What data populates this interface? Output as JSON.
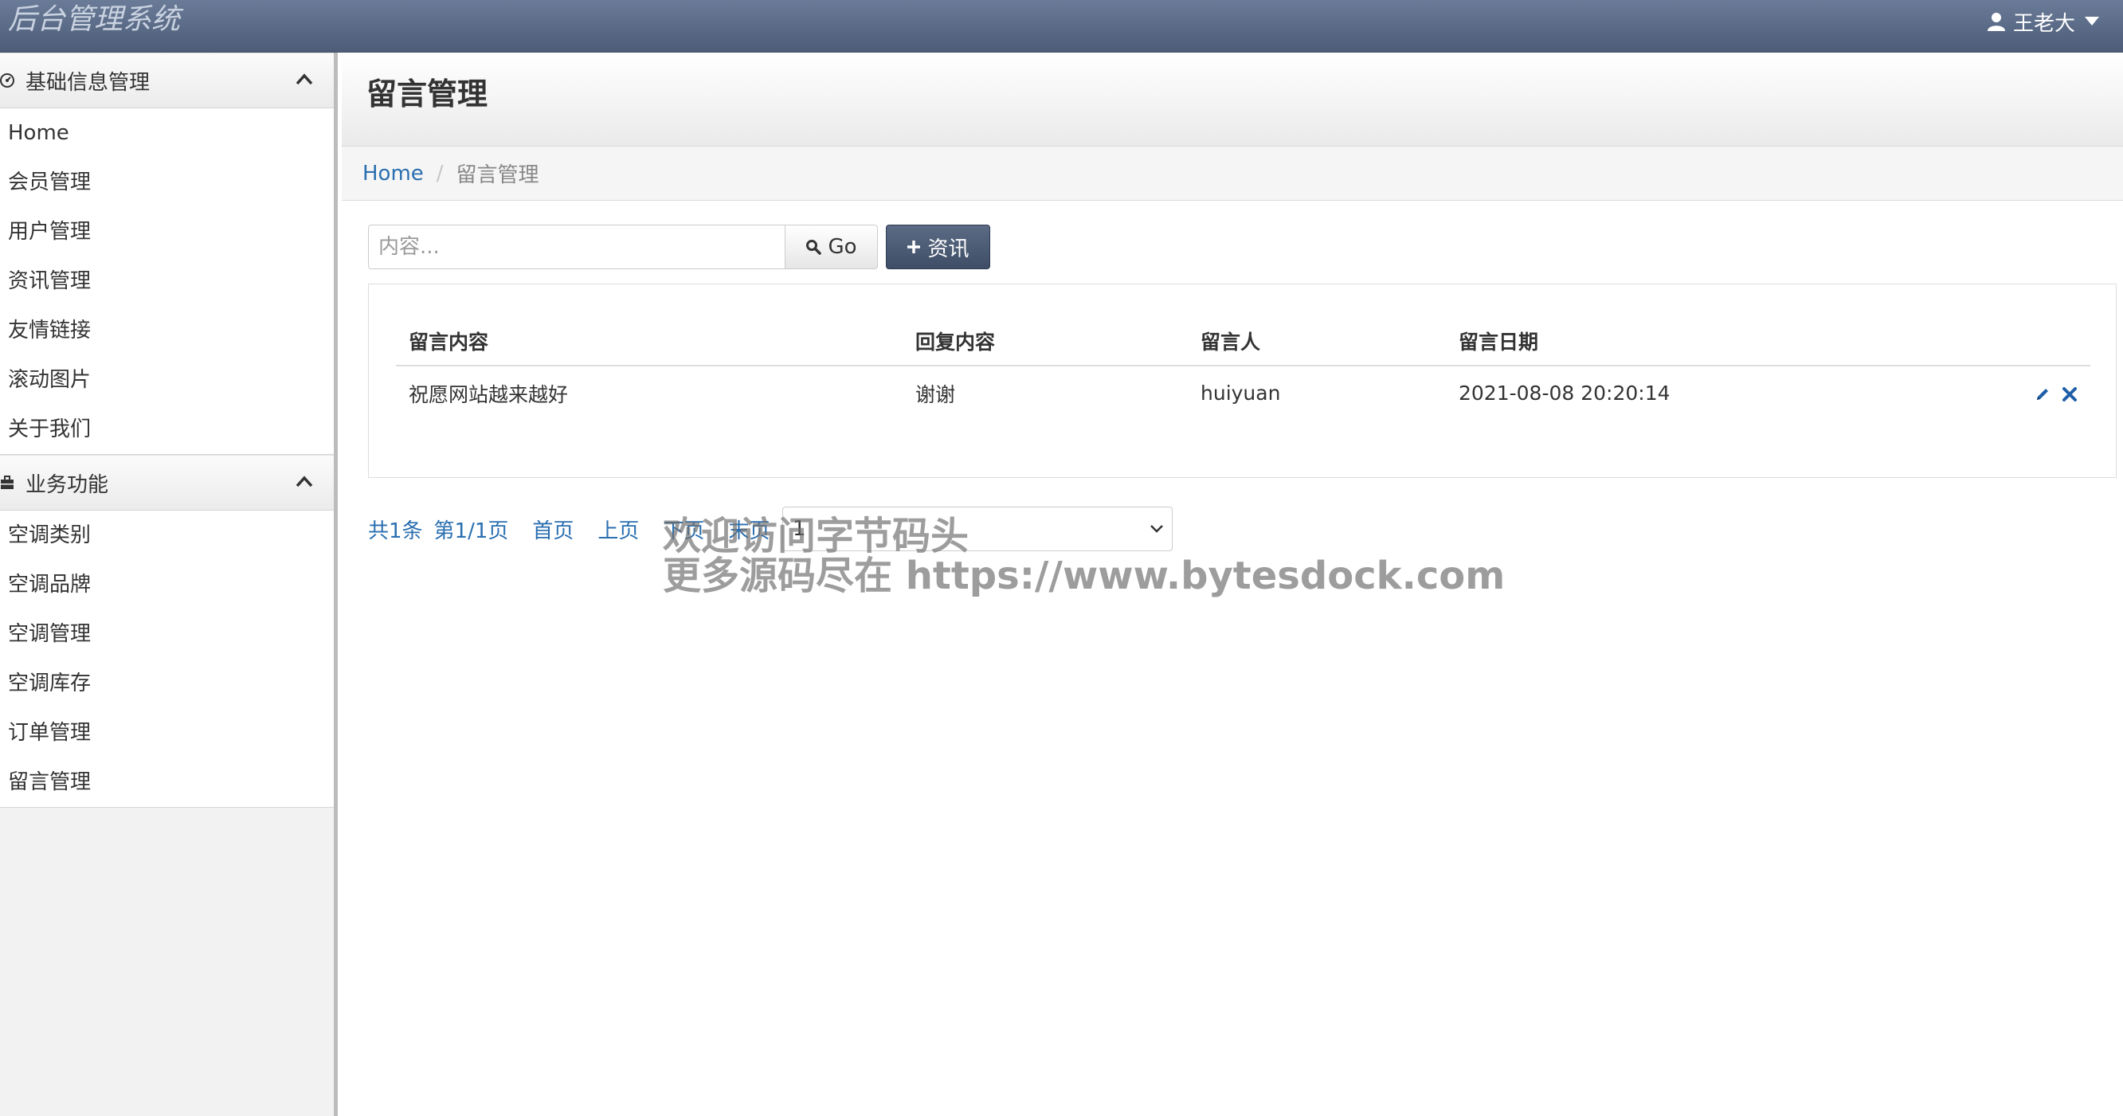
{
  "app": {
    "brand": "后台管理系统",
    "user_name": "王老大"
  },
  "sidebar": {
    "sections": [
      {
        "title": "基础信息管理",
        "items": [
          "Home",
          "会员管理",
          "用户管理",
          "资讯管理",
          "友情链接",
          "滚动图片",
          "关于我们"
        ]
      },
      {
        "title": "业务功能",
        "items": [
          "空调类别",
          "空调品牌",
          "空调管理",
          "空调库存",
          "订单管理",
          "留言管理"
        ]
      }
    ]
  },
  "page": {
    "title": "留言管理",
    "breadcrumb": {
      "home": "Home",
      "separator": "/",
      "current": "留言管理"
    }
  },
  "toolbar": {
    "search_placeholder": "内容...",
    "go_label": "Go",
    "add_label": "资讯"
  },
  "table": {
    "headers": [
      "留言内容",
      "回复内容",
      "留言人",
      "留言日期"
    ],
    "rows": [
      [
        "祝愿网站越来越好",
        "谢谢",
        "huiyuan",
        "2021-08-08 20:20:14"
      ]
    ]
  },
  "pagination": {
    "total": "共1条",
    "page_info": "第1/1页",
    "first": "首页",
    "prev": "上页",
    "next": "下页",
    "last": "末页",
    "selected_page": "1"
  },
  "watermark": {
    "line1": "欢迎访问字节码头",
    "line2": "更多源码尽在  https://www.bytesdock.com"
  },
  "colors": {
    "topbar": "#566680",
    "link": "#2a6fb0",
    "primary_button": "#4a5870",
    "delete_icon": "#1f5fa8"
  }
}
